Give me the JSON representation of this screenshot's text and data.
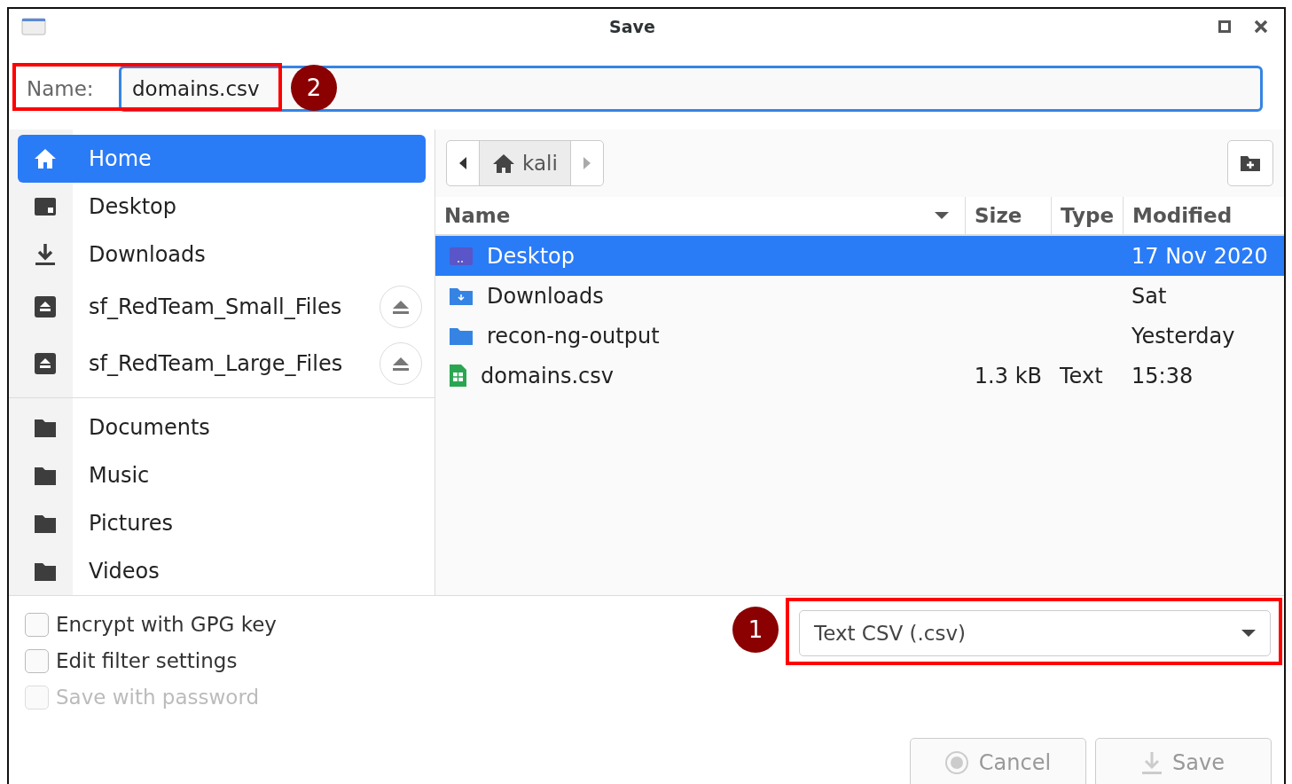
{
  "window": {
    "title": "Save"
  },
  "name_field": {
    "label": "Name:",
    "value": "domains.csv"
  },
  "sidebar": {
    "groups": [
      [
        {
          "label": "Home",
          "kind": "home",
          "selected": true,
          "eject": false
        },
        {
          "label": "Desktop",
          "kind": "desktop",
          "selected": false,
          "eject": false
        },
        {
          "label": "Downloads",
          "kind": "download",
          "selected": false,
          "eject": false
        },
        {
          "label": "sf_RedTeam_Small_Files",
          "kind": "drive",
          "selected": false,
          "eject": true
        },
        {
          "label": "sf_RedTeam_Large_Files",
          "kind": "drive",
          "selected": false,
          "eject": true
        }
      ],
      [
        {
          "label": "Documents",
          "kind": "folder",
          "selected": false,
          "eject": false
        },
        {
          "label": "Music",
          "kind": "folder",
          "selected": false,
          "eject": false
        },
        {
          "label": "Pictures",
          "kind": "folder",
          "selected": false,
          "eject": false
        },
        {
          "label": "Videos",
          "kind": "folder",
          "selected": false,
          "eject": false
        }
      ]
    ]
  },
  "path_bar": {
    "segments": [
      {
        "label": "kali",
        "selected": true
      }
    ]
  },
  "table": {
    "columns": [
      "Name",
      "Size",
      "Type",
      "Modified"
    ],
    "rows": [
      {
        "kind": "desktop",
        "name": "Desktop",
        "size": "",
        "type": "",
        "modified": "17 Nov 2020",
        "selected": true
      },
      {
        "kind": "download",
        "name": "Downloads",
        "size": "",
        "type": "",
        "modified": "Sat",
        "selected": false
      },
      {
        "kind": "folder",
        "name": "recon-ng-output",
        "size": "",
        "type": "",
        "modified": "Yesterday",
        "selected": false
      },
      {
        "kind": "sheet",
        "name": "domains.csv",
        "size": "1.3 kB",
        "type": "Text",
        "modified": "15:38",
        "selected": false
      }
    ]
  },
  "options": [
    {
      "label": "Encrypt with GPG key",
      "checked": false,
      "disabled": false
    },
    {
      "label": "Edit filter settings",
      "checked": false,
      "disabled": false
    },
    {
      "label": "Save with password",
      "checked": false,
      "disabled": true
    }
  ],
  "file_type": {
    "value": "Text CSV (.csv)"
  },
  "buttons": [
    {
      "kind": "cancel",
      "label": "Cancel",
      "disabled": true
    },
    {
      "kind": "save",
      "label": "Save",
      "disabled": true
    }
  ],
  "annotations": [
    {
      "number": "2"
    },
    {
      "number": "1"
    }
  ]
}
